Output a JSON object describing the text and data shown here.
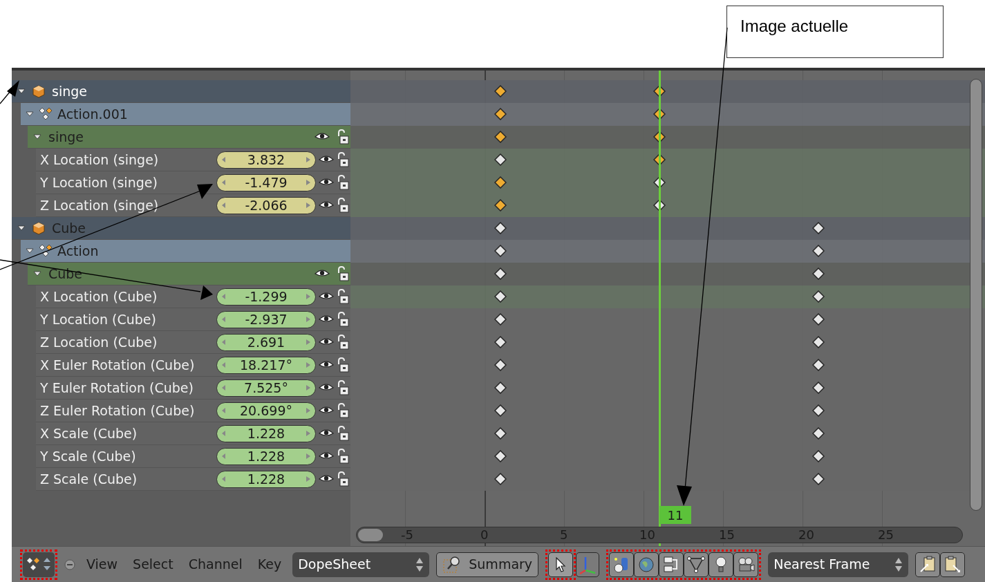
{
  "annotation": {
    "label": "Image actuelle"
  },
  "channels": [
    {
      "kind": "object",
      "name": "singe",
      "expanded": true,
      "selected": true,
      "keys": [
        {
          "kind": "selected"
        },
        {
          "kind": "selected"
        },
        {
          "kind": "empty"
        }
      ],
      "children": [
        {
          "kind": "action",
          "name": "Action.001",
          "expanded": true,
          "keys": [
            {
              "kind": "selected"
            },
            {
              "kind": "selected"
            },
            {
              "kind": "empty"
            }
          ],
          "children": [
            {
              "kind": "group",
              "name": "singe",
              "expanded": true,
              "keys": [
                {
                  "kind": "selected"
                },
                {
                  "kind": "selected"
                },
                {
                  "kind": "empty"
                }
              ],
              "children": [
                {
                  "kind": "fcurve",
                  "name": "X Location (singe)",
                  "value": "3.832",
                  "color": "#d6d291",
                  "selected": true,
                  "keys": [
                    {
                      "kind": "unselected"
                    },
                    {
                      "kind": "selected"
                    },
                    {
                      "kind": "empty"
                    }
                  ]
                },
                {
                  "kind": "fcurve",
                  "name": "Y Location (singe)",
                  "value": "-1.479",
                  "color": "#d6d291",
                  "selected": true,
                  "keys": [
                    {
                      "kind": "selected"
                    },
                    {
                      "kind": "unselected"
                    },
                    {
                      "kind": "empty"
                    }
                  ]
                },
                {
                  "kind": "fcurve",
                  "name": "Z Location (singe)",
                  "value": "-2.066",
                  "color": "#d6d291",
                  "selected": true,
                  "keys": [
                    {
                      "kind": "selected"
                    },
                    {
                      "kind": "unselected"
                    },
                    {
                      "kind": "empty"
                    }
                  ]
                }
              ]
            }
          ]
        }
      ]
    },
    {
      "kind": "object",
      "name": "Cube",
      "expanded": true,
      "selected": false,
      "keys": [
        {
          "kind": "unselected"
        },
        {
          "kind": "empty"
        },
        {
          "kind": "unselected"
        }
      ],
      "children": [
        {
          "kind": "action",
          "name": "Action",
          "expanded": true,
          "keys": [
            {
              "kind": "unselected"
            },
            {
              "kind": "empty"
            },
            {
              "kind": "unselected"
            }
          ],
          "children": [
            {
              "kind": "group",
              "name": "Cube",
              "expanded": true,
              "keys": [
                {
                  "kind": "unselected"
                },
                {
                  "kind": "empty"
                },
                {
                  "kind": "unselected"
                }
              ],
              "children": [
                {
                  "kind": "fcurve",
                  "name": "X Location (Cube)",
                  "value": "-1.299",
                  "color": "#a3cf8c",
                  "selected": true,
                  "keys": [
                    {
                      "kind": "unselected"
                    },
                    {
                      "kind": "empty"
                    },
                    {
                      "kind": "unselected"
                    }
                  ]
                },
                {
                  "kind": "fcurve",
                  "name": "Y Location (Cube)",
                  "value": "-2.937",
                  "color": "#a3cf8c",
                  "selected": false,
                  "keys": [
                    {
                      "kind": "unselected"
                    },
                    {
                      "kind": "empty"
                    },
                    {
                      "kind": "unselected"
                    }
                  ]
                },
                {
                  "kind": "fcurve",
                  "name": "Z Location (Cube)",
                  "value": "2.691",
                  "color": "#a3cf8c",
                  "selected": false,
                  "keys": [
                    {
                      "kind": "unselected"
                    },
                    {
                      "kind": "empty"
                    },
                    {
                      "kind": "unselected"
                    }
                  ]
                },
                {
                  "kind": "fcurve",
                  "name": "X Euler Rotation (Cube)",
                  "value": "18.217°",
                  "color": "#a3cf8c",
                  "selected": false,
                  "keys": [
                    {
                      "kind": "unselected"
                    },
                    {
                      "kind": "empty"
                    },
                    {
                      "kind": "unselected"
                    }
                  ]
                },
                {
                  "kind": "fcurve",
                  "name": "Y Euler Rotation (Cube)",
                  "value": "7.525°",
                  "color": "#a3cf8c",
                  "selected": false,
                  "keys": [
                    {
                      "kind": "unselected"
                    },
                    {
                      "kind": "empty"
                    },
                    {
                      "kind": "unselected"
                    }
                  ]
                },
                {
                  "kind": "fcurve",
                  "name": "Z Euler Rotation (Cube)",
                  "value": "20.699°",
                  "color": "#a3cf8c",
                  "selected": false,
                  "keys": [
                    {
                      "kind": "unselected"
                    },
                    {
                      "kind": "empty"
                    },
                    {
                      "kind": "unselected"
                    }
                  ]
                },
                {
                  "kind": "fcurve",
                  "name": "X Scale (Cube)",
                  "value": "1.228",
                  "color": "#a3cf8c",
                  "selected": false,
                  "keys": [
                    {
                      "kind": "unselected"
                    },
                    {
                      "kind": "empty"
                    },
                    {
                      "kind": "unselected"
                    }
                  ]
                },
                {
                  "kind": "fcurve",
                  "name": "Y Scale (Cube)",
                  "value": "1.228",
                  "color": "#a3cf8c",
                  "selected": false,
                  "keys": [
                    {
                      "kind": "unselected"
                    },
                    {
                      "kind": "empty"
                    },
                    {
                      "kind": "unselected"
                    }
                  ]
                },
                {
                  "kind": "fcurve",
                  "name": "Z Scale (Cube)",
                  "value": "1.228",
                  "color": "#a3cf8c",
                  "selected": false,
                  "keys": [
                    {
                      "kind": "unselected"
                    },
                    {
                      "kind": "empty"
                    },
                    {
                      "kind": "unselected"
                    }
                  ]
                }
              ]
            }
          ]
        }
      ]
    }
  ],
  "timeline": {
    "ticks": [
      "-5",
      "0",
      "5",
      "10",
      "15",
      "20",
      "25"
    ],
    "current_frame": "11"
  },
  "header": {
    "menus": [
      "View",
      "Select",
      "Channel",
      "Key"
    ],
    "mode": "DopeSheet",
    "summary": "Summary",
    "snap": "Nearest Frame"
  }
}
